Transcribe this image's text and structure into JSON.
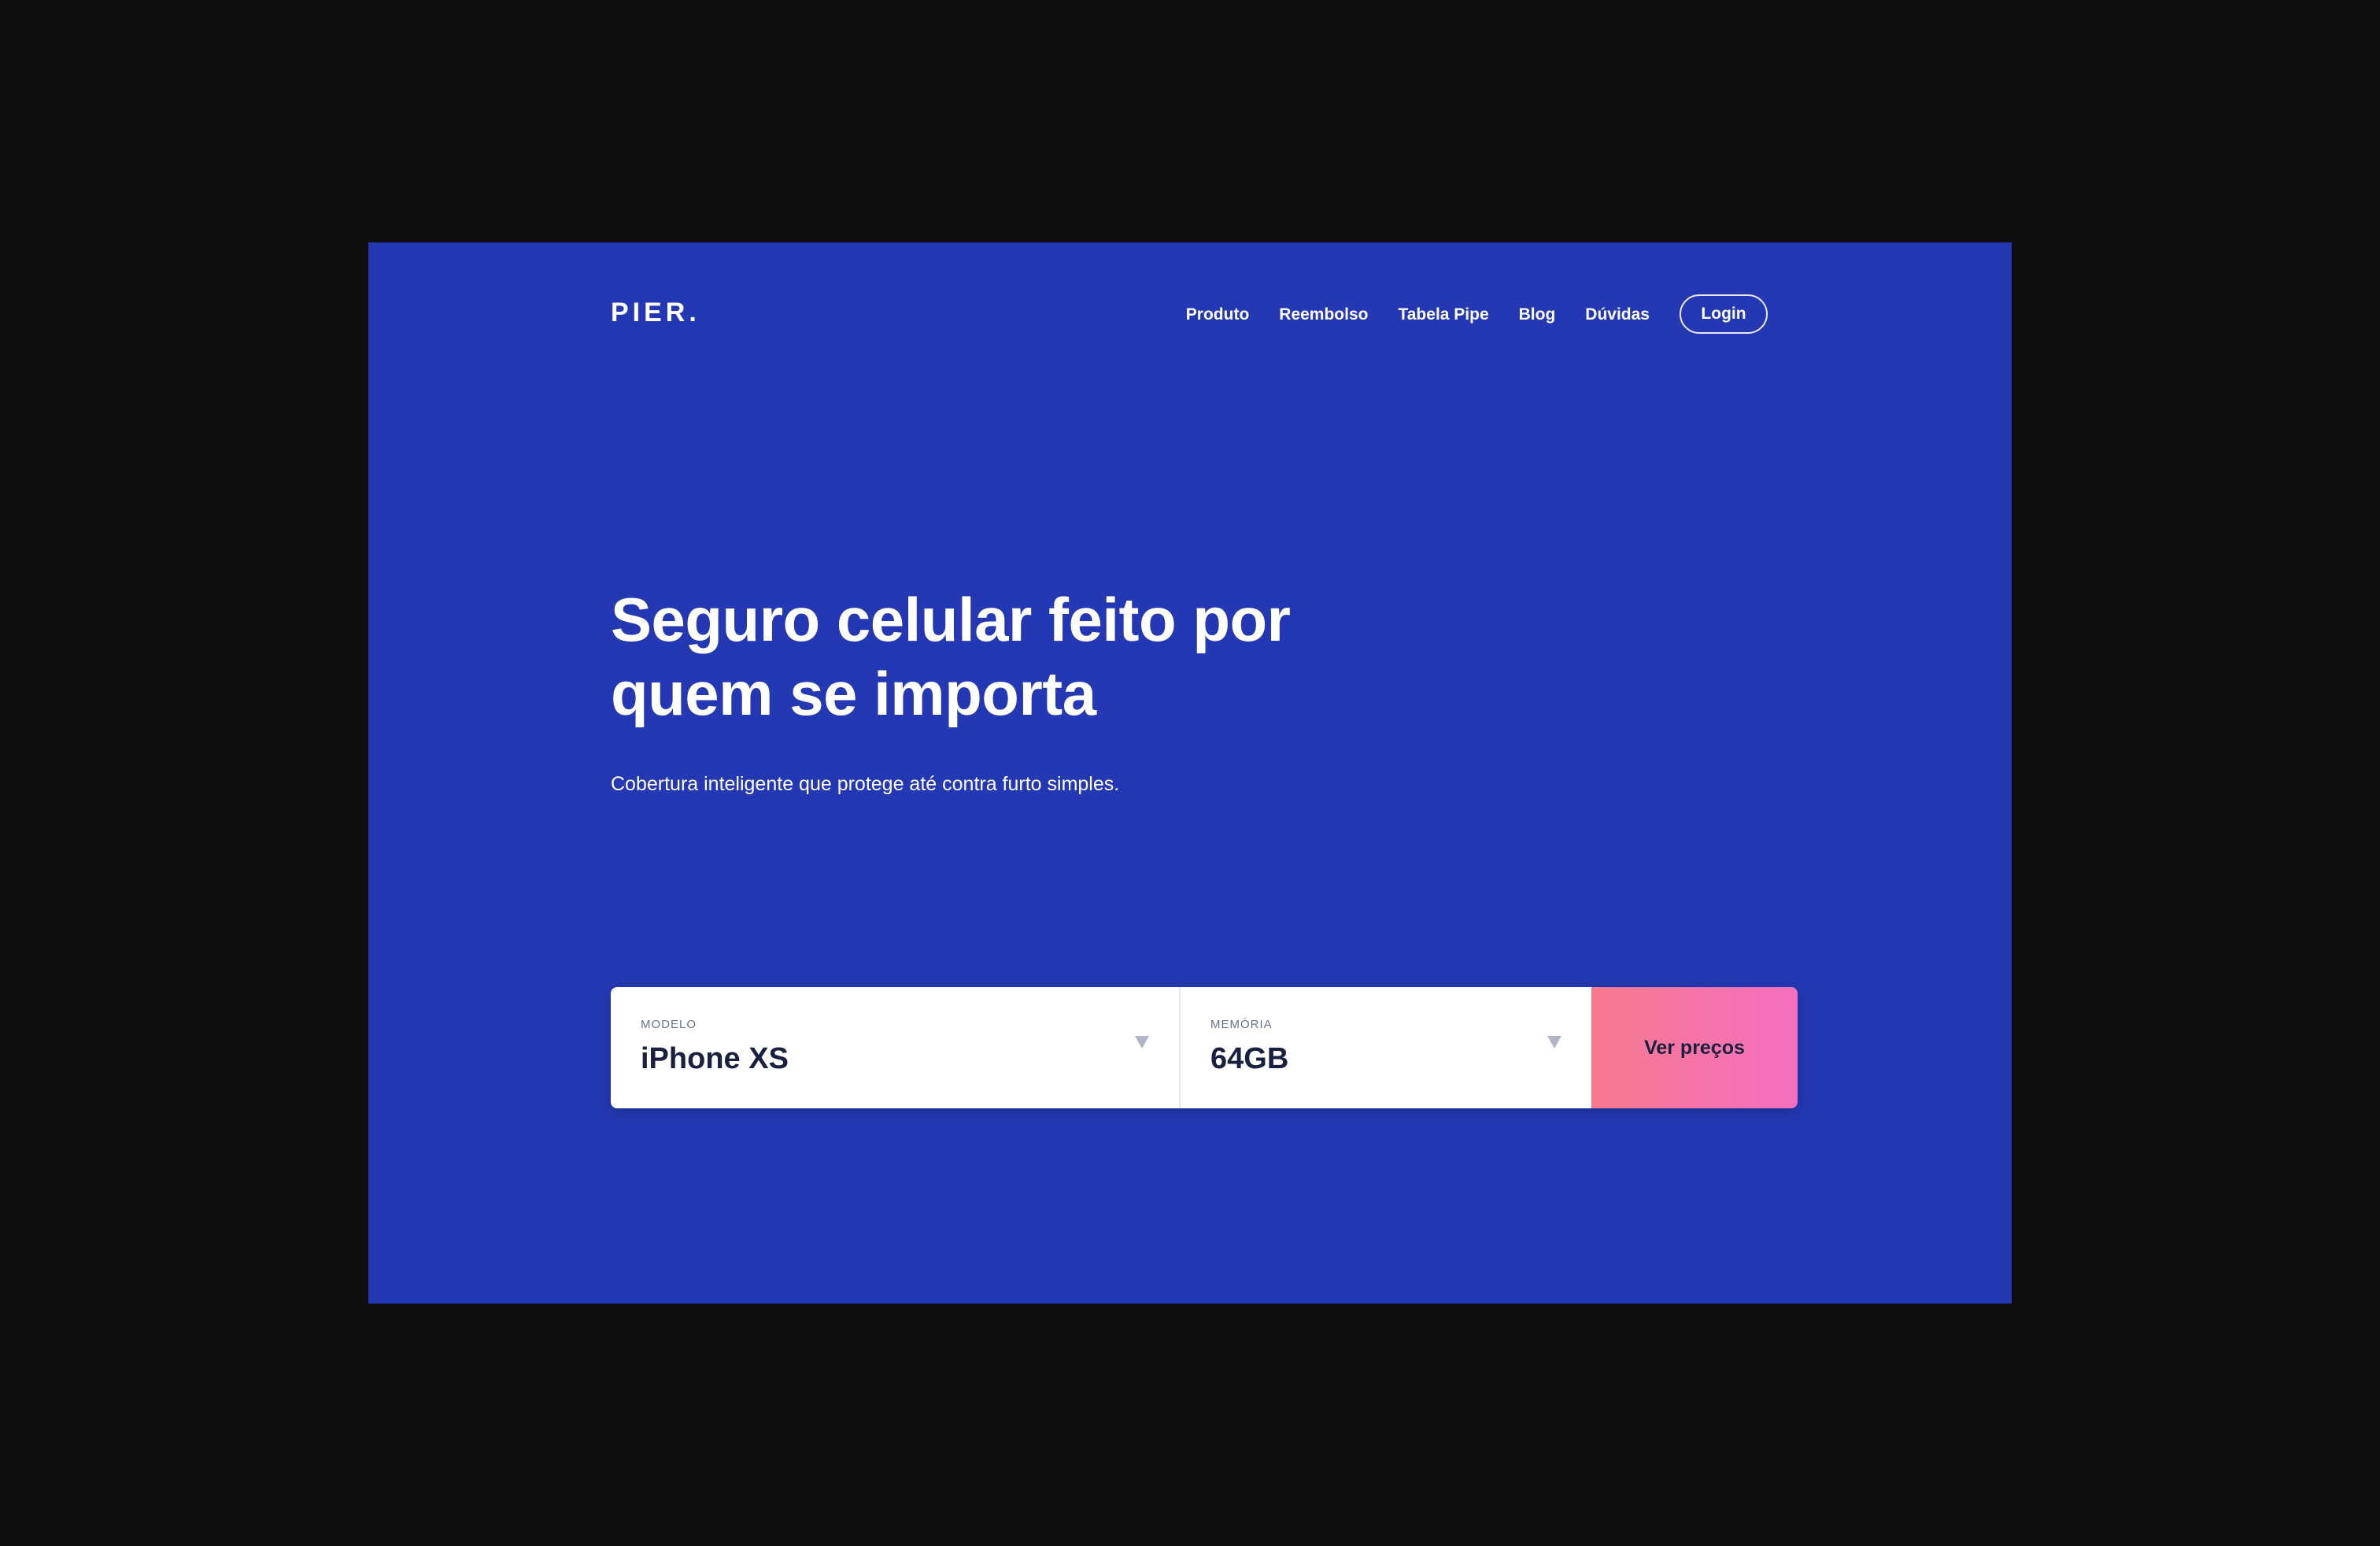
{
  "brand": {
    "logo_text": "PIER."
  },
  "nav": {
    "items": [
      {
        "label": "Produto"
      },
      {
        "label": "Reembolso"
      },
      {
        "label": "Tabela Pipe"
      },
      {
        "label": "Blog"
      },
      {
        "label": "Dúvidas"
      }
    ],
    "login_label": "Login"
  },
  "hero": {
    "title_line1": "Seguro celular feito por",
    "title_line2": "quem se importa",
    "subtitle": "Cobertura inteligente que protege até contra furto simples."
  },
  "quote_form": {
    "model": {
      "label": "MODELO",
      "value": "iPhone XS"
    },
    "memory": {
      "label": "MEMÓRIA",
      "value": "64GB"
    },
    "cta_label": "Ver preços"
  },
  "icons": {
    "model_dropdown": "chevron-down-icon",
    "memory_dropdown": "chevron-down-icon"
  },
  "colors": {
    "page_background": "#0e0e0e",
    "hero_background": "#2438b3",
    "cta_gradient_start": "#f77a8e",
    "cta_gradient_end": "#f46fc0",
    "text_dark": "#1a2040"
  }
}
